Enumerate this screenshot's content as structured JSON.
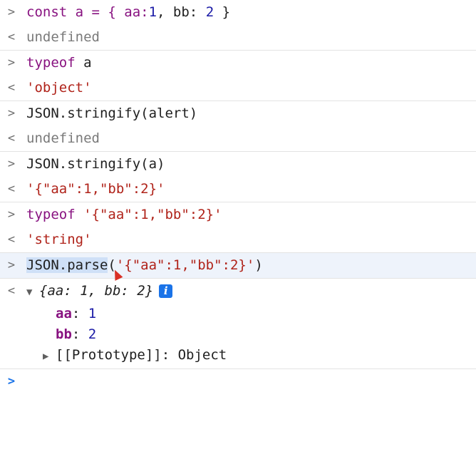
{
  "glyphs": {
    "input": ">",
    "output": "<",
    "expanded": "▼",
    "collapsed": "▶",
    "info": "i"
  },
  "entries": [
    {
      "input": [
        "const a = { aa:",
        "1",
        ", bb: ",
        "2",
        " }"
      ],
      "output": "undefined"
    },
    {
      "input": [
        "typeof",
        " a"
      ],
      "output": "'object'"
    },
    {
      "input": "JSON.stringify(alert)",
      "output": "undefined"
    },
    {
      "input": "JSON.stringify(a)",
      "output": "'{\"aa\":1,\"bb\":2}'"
    },
    {
      "input": [
        "typeof",
        " ",
        "'{\"aa\":1,\"bb\":2}'"
      ],
      "output": "'string'"
    },
    {
      "input": [
        "JSON.parse",
        "(",
        "'{\"aa\":1,\"bb\":2}'",
        ")"
      ],
      "output_object": {
        "preview": [
          "{aa: ",
          "1",
          ", bb: ",
          "2",
          "}"
        ],
        "properties": [
          {
            "key": "aa",
            "value": "1"
          },
          {
            "key": "bb",
            "value": "2"
          }
        ],
        "prototype": {
          "label": "[[Prototype]]",
          "value": "Object"
        }
      }
    }
  ],
  "colors": {
    "keyword": "#881280",
    "number": "#1a1aa6",
    "string": "#b0231a",
    "selection": "#cfe0f7",
    "prompt": "#1a73e8"
  }
}
